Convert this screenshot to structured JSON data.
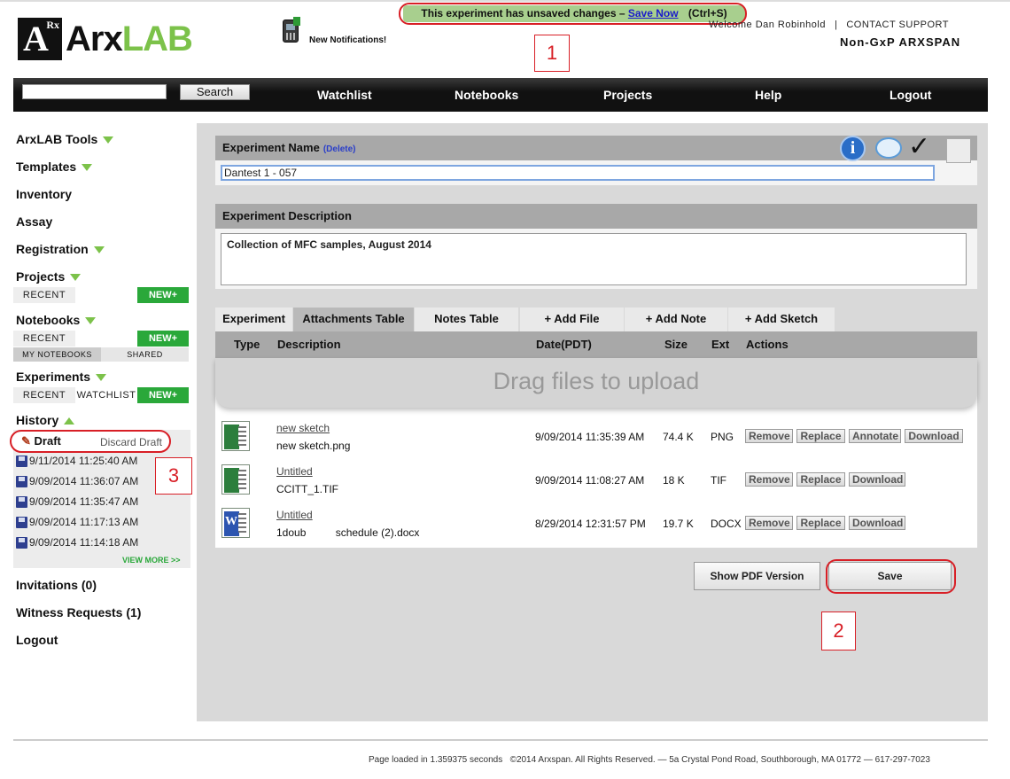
{
  "header": {
    "logo_text": "ArxLAB",
    "notifications_label": "New Notifications!",
    "unsaved_message": "This experiment has unsaved changes –",
    "save_now_link": "Save Now",
    "save_shortcut": "(Ctrl+S)",
    "welcome": "Welcome Dan Robinhold",
    "separator": "|",
    "contact_support": "CONTACT SUPPORT",
    "org_name": "Non-GxP ARXSPAN"
  },
  "callouts": [
    "1",
    "2",
    "3"
  ],
  "nav": {
    "search_placeholder": "",
    "search_button": "Search",
    "items": [
      "Watchlist",
      "Notebooks",
      "Projects",
      "Help",
      "Logout"
    ]
  },
  "sidebar": {
    "arxlab_tools": "ArxLAB Tools",
    "templates": "Templates",
    "inventory": "Inventory",
    "assay": "Assay",
    "registration": "Registration",
    "projects": "Projects",
    "notebooks": "Notebooks",
    "experiments": "Experiments",
    "recent": "RECENT",
    "new_btn": "NEW+",
    "watchlist": "WATCHLIST",
    "my_notebooks": "MY NOTEBOOKS",
    "shared": "SHARED",
    "history": "History",
    "draft": "Draft",
    "discard_draft": "Discard Draft",
    "history_items": [
      "9/11/2014 11:25:40 AM",
      "9/09/2014 11:36:07 AM",
      "9/09/2014 11:35:47 AM",
      "9/09/2014 11:17:13 AM",
      "9/09/2014 11:14:18 AM"
    ],
    "view_more": "VIEW MORE >>",
    "invitations": "Invitations (0)",
    "witness_requests": "Witness Requests (1)",
    "logout": "Logout"
  },
  "experiment": {
    "name_header": "Experiment Name",
    "delete_link": "(Delete)",
    "name_value": "Dantest 1 - 057",
    "description_header": "Experiment Description",
    "description_value": "Collection of MFC samples, August 2014"
  },
  "tabs": [
    "Experiment",
    "Attachments Table",
    "Notes Table",
    "+ Add File",
    "+ Add Note",
    "+ Add Sketch"
  ],
  "table": {
    "columns": [
      "Type",
      "Description",
      "Date(PDT)",
      "Size",
      "Ext",
      "Actions"
    ],
    "drop_text": "Drag files to upload",
    "rows": [
      {
        "title": "new sketch",
        "file": "new sketch.png",
        "date": "9/09/2014 11:35:39 AM",
        "size": "74.4 K",
        "ext": "PNG",
        "actions": [
          "Remove",
          "Replace",
          "Annotate",
          "Download"
        ]
      },
      {
        "title": "Untitled",
        "file": "CCITT_1.TIF",
        "date": "9/09/2014 11:08:27 AM",
        "size": "18 K",
        "ext": "TIF",
        "actions": [
          "Remove",
          "Replace",
          "Download"
        ]
      },
      {
        "title": "Untitled",
        "file": "1doub          schedule (2).docx",
        "date": "8/29/2014 12:31:57 PM",
        "size": "19.7 K",
        "ext": "DOCX",
        "actions": [
          "Remove",
          "Replace",
          "Download"
        ]
      }
    ]
  },
  "buttons": {
    "show_pdf": "Show PDF Version",
    "save": "Save"
  },
  "footer": "Page loaded in 1.359375 seconds   ©2014 Arxspan. All Rights Reserved. — 5a Crystal Pond Road, Southborough, MA 01772 — 617-297-7023"
}
